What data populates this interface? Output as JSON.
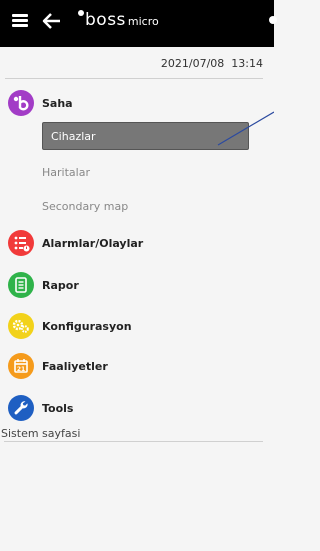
{
  "header": {
    "logo_mark": "boss",
    "logo_word": "micro",
    "colors": {
      "bar": "#000000",
      "text": "#ffffff"
    }
  },
  "datetime": "2021/07/08  13:14",
  "menu": [
    {
      "label": "Saha",
      "icon": "saha-icon",
      "color": "#a23cc6",
      "items": [
        {
          "label": "Cihazlar",
          "active": true
        },
        {
          "label": "Haritalar",
          "active": false
        },
        {
          "label": "Secondary map",
          "active": false
        }
      ]
    },
    {
      "label": "Alarmlar/Olaylar",
      "icon": "alarm-list-icon",
      "color": "#f13a3a"
    },
    {
      "label": "Rapor",
      "icon": "report-icon",
      "color": "#2fb34a"
    },
    {
      "label": "Konfigurasyon",
      "icon": "config-icon",
      "color": "#f2d21a"
    },
    {
      "label": "Faaliyetler",
      "icon": "calendar-icon",
      "color": "#f59b1c",
      "calendar_day": "21"
    },
    {
      "label": "Tools",
      "icon": "wrench-icon",
      "color": "#1f5fc2"
    }
  ],
  "footer": {
    "label": "Sistem sayfasi"
  }
}
